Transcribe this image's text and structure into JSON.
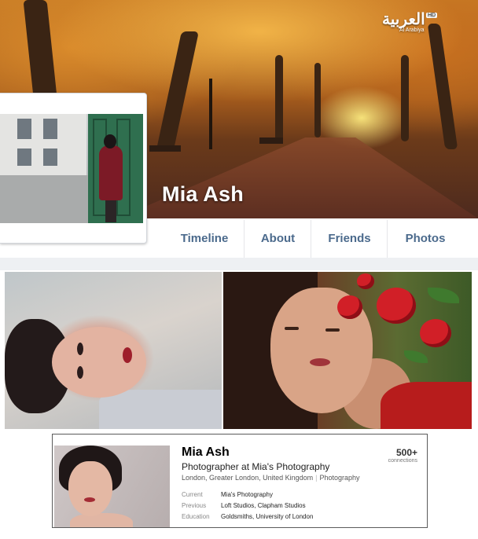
{
  "watermark": {
    "arabic": "العربية",
    "hd": "HD",
    "english": "Al Arabiya"
  },
  "facebook": {
    "cover_name": "Mia Ash",
    "tabs": [
      "Timeline",
      "About",
      "Friends",
      "Photos"
    ]
  },
  "linkedin": {
    "name": "Mia Ash",
    "headline": "Photographer at Mia's Photography",
    "location": "London, Greater London, United Kingdom",
    "industry": "Photography",
    "connections_count": "500+",
    "connections_label": "connections",
    "rows": [
      {
        "label": "Current",
        "value": "Mia's Photography"
      },
      {
        "label": "Previous",
        "value": "Loft Studios, Clapham Studios"
      },
      {
        "label": "Education",
        "value": "Goldsmiths, University of London"
      }
    ]
  }
}
